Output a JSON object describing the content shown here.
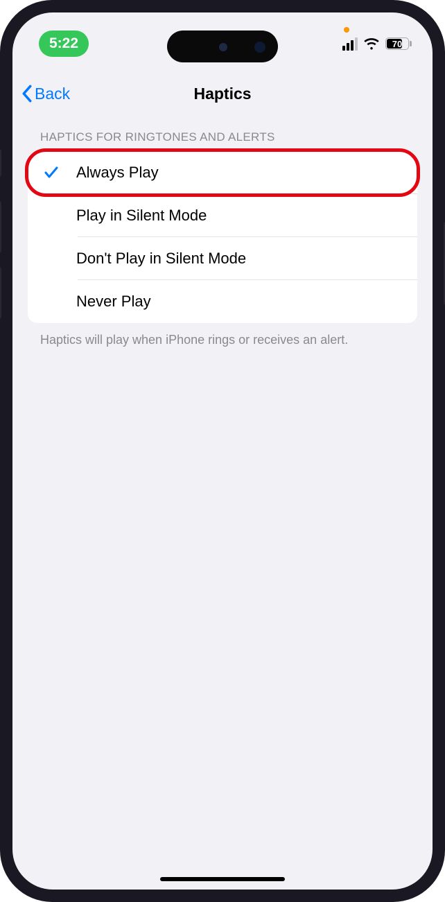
{
  "status_bar": {
    "time": "5:22",
    "battery_pct": "70"
  },
  "nav": {
    "back_label": "Back",
    "title": "Haptics"
  },
  "section": {
    "header": "HAPTICS FOR RINGTONES AND ALERTS",
    "footer": "Haptics will play when iPhone rings or receives an alert."
  },
  "options": [
    {
      "label": "Always Play",
      "selected": true
    },
    {
      "label": "Play in Silent Mode",
      "selected": false
    },
    {
      "label": "Don't Play in Silent Mode",
      "selected": false
    },
    {
      "label": "Never Play",
      "selected": false
    }
  ],
  "highlight_index": 0
}
